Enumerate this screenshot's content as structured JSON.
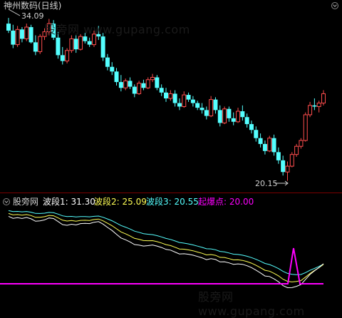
{
  "main_panel": {
    "title": "神州数码(日线)",
    "max_price_label": "34.09",
    "min_price_label": "20.15"
  },
  "indicator_panel": {
    "name": "股旁网",
    "items": [
      {
        "label": "波段1: 31.30",
        "color": "#ffffff"
      },
      {
        "label": "波段2: 25.09",
        "color": "#ffff55"
      },
      {
        "label": "波段3: 20.55",
        "color": "#55ffff"
      },
      {
        "label": "起爆点: 20.00",
        "color": "#ff00ff"
      }
    ]
  },
  "watermark": {
    "top": "股旁网 www.gupang.com",
    "bottom": "股旁网 www.gupang.com"
  },
  "colors": {
    "up": "#ff4d4d",
    "down": "#54ffff",
    "separator": "#7a0000",
    "background": "#000000"
  },
  "chart_data": [
    {
      "type": "candlestick",
      "title": "神州数码(日线)",
      "annotations": [
        "34.09",
        "20.15"
      ],
      "high": 34.09,
      "low": 20.15,
      "candles": [
        [
          33.6,
          34.09,
          32.8,
          33.0
        ],
        [
          33.0,
          33.5,
          31.5,
          31.8
        ],
        [
          31.8,
          33.4,
          31.6,
          33.1
        ],
        [
          33.1,
          33.3,
          32.0,
          32.3
        ],
        [
          32.3,
          33.6,
          32.1,
          33.3
        ],
        [
          33.3,
          33.5,
          31.9,
          32.0
        ],
        [
          32.0,
          32.6,
          30.9,
          31.2
        ],
        [
          31.2,
          32.7,
          31.0,
          32.5
        ],
        [
          32.5,
          33.2,
          32.2,
          32.9
        ],
        [
          32.9,
          34.0,
          32.6,
          33.6
        ],
        [
          33.6,
          33.9,
          32.2,
          32.4
        ],
        [
          32.4,
          32.9,
          30.6,
          30.9
        ],
        [
          30.9,
          31.6,
          30.1,
          30.4
        ],
        [
          30.4,
          31.5,
          30.2,
          31.3
        ],
        [
          31.3,
          32.6,
          31.1,
          32.3
        ],
        [
          32.3,
          32.6,
          31.1,
          31.4
        ],
        [
          31.4,
          32.7,
          31.3,
          32.5
        ],
        [
          32.5,
          32.8,
          31.9,
          32.1
        ],
        [
          32.1,
          32.4,
          31.6,
          31.8
        ],
        [
          31.8,
          33.0,
          31.6,
          32.7
        ],
        [
          32.7,
          33.4,
          32.2,
          32.5
        ],
        [
          32.5,
          32.8,
          30.4,
          30.7
        ],
        [
          30.7,
          31.0,
          29.6,
          29.9
        ],
        [
          29.9,
          30.3,
          29.2,
          29.5
        ],
        [
          29.5,
          29.8,
          28.3,
          28.6
        ],
        [
          28.6,
          29.2,
          27.8,
          28.1
        ],
        [
          28.1,
          28.9,
          27.9,
          28.7
        ],
        [
          28.7,
          29.0,
          28.0,
          28.2
        ],
        [
          28.2,
          28.4,
          27.3,
          27.6
        ],
        [
          27.6,
          28.7,
          27.5,
          28.5
        ],
        [
          28.5,
          28.8,
          27.9,
          28.1
        ],
        [
          28.1,
          29.0,
          28.0,
          28.8
        ],
        [
          28.8,
          29.3,
          28.6,
          29.0
        ],
        [
          29.0,
          29.2,
          27.9,
          28.1
        ],
        [
          28.1,
          28.4,
          27.4,
          27.7
        ],
        [
          27.7,
          28.1,
          26.9,
          27.2
        ],
        [
          27.2,
          27.9,
          27.0,
          27.6
        ],
        [
          27.6,
          27.9,
          26.5,
          26.8
        ],
        [
          26.8,
          27.2,
          26.2,
          26.5
        ],
        [
          26.5,
          27.8,
          26.4,
          27.5
        ],
        [
          27.5,
          27.7,
          26.9,
          27.1
        ],
        [
          27.1,
          27.4,
          26.5,
          26.8
        ],
        [
          26.8,
          27.0,
          26.2,
          26.4
        ],
        [
          26.4,
          26.8,
          25.9,
          26.2
        ],
        [
          26.2,
          26.5,
          25.4,
          25.7
        ],
        [
          25.7,
          27.4,
          25.6,
          27.1
        ],
        [
          27.1,
          27.3,
          25.9,
          26.2
        ],
        [
          26.2,
          26.6,
          24.8,
          25.1
        ],
        [
          25.1,
          26.5,
          25.0,
          26.3
        ],
        [
          26.3,
          26.5,
          25.2,
          25.5
        ],
        [
          25.5,
          26.0,
          24.9,
          25.2
        ],
        [
          25.2,
          26.4,
          25.1,
          26.1
        ],
        [
          26.1,
          26.6,
          25.3,
          25.6
        ],
        [
          25.6,
          25.9,
          24.7,
          25.0
        ],
        [
          25.0,
          25.3,
          24.2,
          24.5
        ],
        [
          24.5,
          24.8,
          23.5,
          23.8
        ],
        [
          23.8,
          24.2,
          23.0,
          23.3
        ],
        [
          23.3,
          23.6,
          22.4,
          22.7
        ],
        [
          22.7,
          24.0,
          22.6,
          23.8
        ],
        [
          23.8,
          24.1,
          22.3,
          22.6
        ],
        [
          22.6,
          23.0,
          21.6,
          21.9
        ],
        [
          21.9,
          22.3,
          20.6,
          20.9
        ],
        [
          20.9,
          21.8,
          20.15,
          21.4
        ],
        [
          21.4,
          22.6,
          21.3,
          22.4
        ],
        [
          22.4,
          23.3,
          22.2,
          23.1
        ],
        [
          23.1,
          23.8,
          22.9,
          23.6
        ],
        [
          23.6,
          26.0,
          23.5,
          25.8
        ],
        [
          25.8,
          26.9,
          25.6,
          26.6
        ],
        [
          26.6,
          27.2,
          26.2,
          26.5
        ],
        [
          26.5,
          27.0,
          26.0,
          26.8
        ],
        [
          26.8,
          27.9,
          26.6,
          27.6
        ]
      ]
    },
    {
      "type": "line",
      "series": [
        {
          "name": "波段1",
          "color": "#ffffff",
          "last": 31.3
        },
        {
          "name": "波段2",
          "color": "#ffff55",
          "last": 25.09
        },
        {
          "name": "波段3",
          "color": "#55ffff",
          "last": 20.55
        },
        {
          "name": "起爆点",
          "color": "#ff00ff",
          "last": 20.0
        }
      ]
    }
  ]
}
